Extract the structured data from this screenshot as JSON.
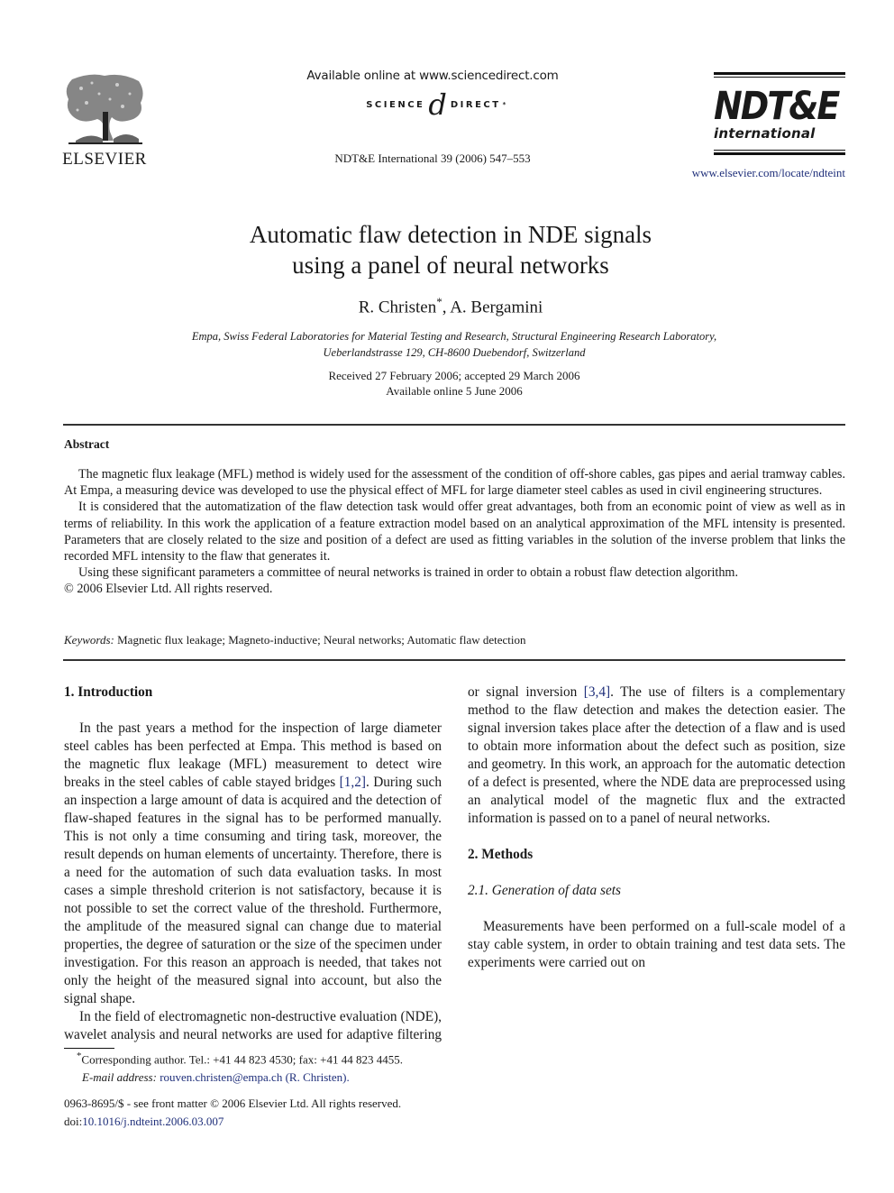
{
  "header": {
    "publisher_logo_text": "ELSEVIER",
    "sciencedirect_available": "Available online at www.sciencedirect.com",
    "sciencedirect_logo_left": "SCIENCE",
    "sciencedirect_logo_at": "d",
    "sciencedirect_logo_right": "DIRECT",
    "sciencedirect_logo_mark": "*",
    "journal_citation": "NDT&E International 39 (2006) 547–553",
    "journal_logo_main": "NDT&E",
    "journal_logo_sub": "international",
    "journal_url": "www.elsevier.com/locate/ndteint"
  },
  "article": {
    "title_line1": "Automatic flaw detection in NDE signals",
    "title_line2": "using a panel of neural networks",
    "author1": "R. Christen",
    "author1_mark": "*",
    "author_sep": ", ",
    "author2": "A. Bergamini",
    "affiliation_line1": "Empa, Swiss Federal Laboratories for Material Testing and Research, Structural Engineering Research Laboratory,",
    "affiliation_line2": "Ueberlandstrasse 129, CH-8600 Duebendorf, Switzerland",
    "received": "Received 27 February 2006; accepted 29 March 2006",
    "available_online": "Available online 5 June 2006"
  },
  "abstract": {
    "heading": "Abstract",
    "paragraphs": [
      "The magnetic flux leakage (MFL) method is widely used for the assessment of the condition of off-shore cables, gas pipes and aerial tramway cables. At Empa, a measuring device was developed to use the physical effect of MFL for large diameter steel cables as used in civil engineering structures.",
      "It is considered that the automatization of the flaw detection task would offer great advantages, both from an economic point of view as well as in terms of reliability. In this work the application of a feature extraction model based on an analytical approximation of the MFL intensity is presented. Parameters that are closely related to the size and position of a defect are used as fitting variables in the solution of the inverse problem that links the recorded MFL intensity to the flaw that generates it.",
      "Using these significant parameters a committee of neural networks is trained in order to obtain a robust flaw detection algorithm."
    ],
    "copyright": "© 2006 Elsevier Ltd. All rights reserved."
  },
  "keywords": {
    "label": "Keywords:",
    "text": "Magnetic flux leakage; Magneto-inductive; Neural networks; Automatic flaw detection"
  },
  "sections": {
    "intro_heading": "1.  Introduction",
    "intro_p1_a": "In the past years a method for the inspection of large diameter steel cables has been perfected at Empa. This method is based on the magnetic flux leakage (MFL) measurement to detect wire breaks in the steel cables of cable stayed bridges ",
    "intro_p1_ref": "[1,2]",
    "intro_p1_b": ". During such an inspection a large amount of data is acquired and the detection of flaw-shaped features in the signal has to be performed manually. This is not only a time consuming and tiring task, moreover, the result depends on human elements of uncertainty. Therefore, there is a need for the automation of such data evaluation tasks. In most cases a simple threshold criterion is not satisfactory, because it is not possible to set the correct value of the threshold. Furthermore, the amplitude of the measured signal can change due to material properties, the degree of saturation or the size of the specimen under investigation. For this reason an approach is needed, that takes not only the height of the measured signal into account, but also the signal shape.",
    "intro_p2_a": "In the field of electromagnetic non-destructive evaluation (NDE), wavelet analysis and neural networks are used for adaptive filtering or signal inversion ",
    "intro_p2_ref": "[3,4]",
    "intro_p2_b": ". The use of filters is a complementary method to the flaw detection and makes the detection easier. The signal inversion takes place after the detection of a flaw and is used to obtain more information about the defect such as position, size and geometry. In this work, an approach for the automatic detection of a defect is presented, where the NDE data are preprocessed using an analytical model of the magnetic flux and the extracted information is passed on to a panel of neural networks.",
    "methods_heading": "2.  Methods",
    "sub21_heading": "2.1.  Generation of data sets",
    "methods_p1": "Measurements have been performed on a full-scale model of a stay cable system, in order to obtain training and test data sets. The experiments were carried out on"
  },
  "footnotes": {
    "corresponding_mark": "*",
    "corresponding": "Corresponding author. Tel.:  +41 44 823 4530; fax:  +41 44 823 4455.",
    "email_label": "E-mail address:",
    "email": "rouven.christen@empa.ch",
    "email_name": " (R. Christen).",
    "front_matter": "0963-8695/$ - see front matter © 2006 Elsevier Ltd. All rights reserved.",
    "doi_label": "doi:",
    "doi": "10.1016/j.ndteint.2006.03.007"
  },
  "colors": {
    "link": "#1f2f7a",
    "text": "#1a1a1a"
  }
}
